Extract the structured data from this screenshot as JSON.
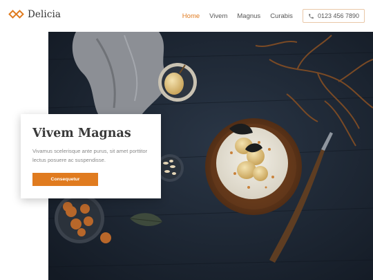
{
  "brand": {
    "name": "Delicia",
    "accent": "#e07b1f"
  },
  "nav": {
    "items": [
      {
        "label": "Home",
        "active": true
      },
      {
        "label": "Vivem",
        "active": false
      },
      {
        "label": "Magnus",
        "active": false
      },
      {
        "label": "Curabis",
        "active": false
      }
    ],
    "phone": {
      "icon": "phone-icon",
      "label": "0123 456 7890"
    }
  },
  "hero": {
    "card": {
      "title": "Vivem Magnas",
      "text": "Vivamus scelerisque ante purus, sit amet porttitor lectus posuere ac suspendisse.",
      "button": "Consequetur"
    }
  }
}
